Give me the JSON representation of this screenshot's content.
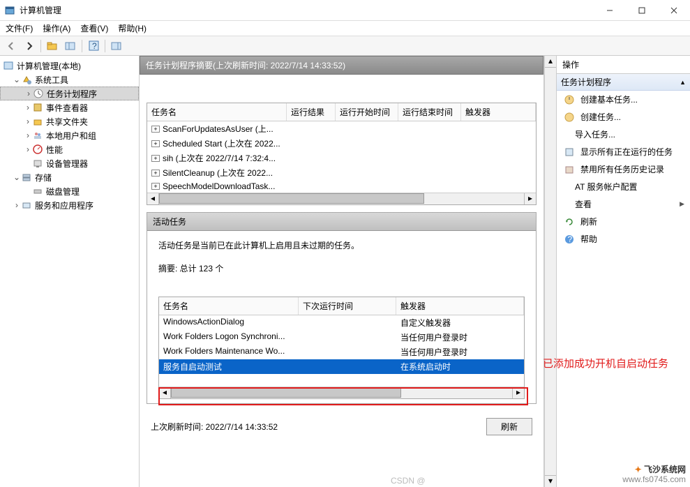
{
  "window": {
    "title": "计算机管理"
  },
  "window_controls": {
    "minimize": "minimize",
    "maximize": "maximize",
    "close": "close"
  },
  "menu": {
    "file": "文件(F)",
    "action": "操作(A)",
    "view": "查看(V)",
    "help": "帮助(H)"
  },
  "tree": {
    "root": "计算机管理(本地)",
    "system_tools": "系统工具",
    "task_scheduler": "任务计划程序",
    "event_viewer": "事件查看器",
    "shared_folders": "共享文件夹",
    "local_users": "本地用户和组",
    "performance": "性能",
    "device_manager": "设备管理器",
    "storage": "存储",
    "disk_mgmt": "磁盘管理",
    "services_apps": "服务和应用程序"
  },
  "mid": {
    "summary_header": "任务计划程序摘要(上次刷新时间: 2022/7/14 14:33:52)",
    "cols": {
      "name": "任务名",
      "result": "运行结果",
      "start": "运行开始时间",
      "end": "运行结束时间",
      "trigger": "触发器"
    },
    "tasks": [
      "ScanForUpdatesAsUser (上...",
      "Scheduled Start (上次在 2022...",
      "sih (上次在 2022/7/14 7:32:4...",
      "SilentCleanup (上次在 2022...",
      "SpeechModelDownloadTask..."
    ],
    "active_header": "活动任务",
    "active_desc": "活动任务是当前已在此计算机上启用且未过期的任务。",
    "active_summary": "摘要: 总计 123 个",
    "active_cols": {
      "name": "任务名",
      "next": "下次运行时间",
      "trigger": "触发器"
    },
    "active_rows": [
      {
        "name": "WindowsActionDialog",
        "next": "",
        "trigger": "自定义触发器"
      },
      {
        "name": "Work Folders Logon Synchroni...",
        "next": "",
        "trigger": "当任何用户登录时"
      },
      {
        "name": "Work Folders Maintenance Wo...",
        "next": "",
        "trigger": "当任何用户登录时"
      },
      {
        "name": "服务自启动测试",
        "next": "",
        "trigger": "在系统启动时"
      }
    ],
    "last_refresh": "上次刷新时间: 2022/7/14 14:33:52",
    "refresh_btn": "刷新"
  },
  "actions": {
    "header": "操作",
    "group": "任务计划程序",
    "create_basic": "创建基本任务...",
    "create_task": "创建任务...",
    "import": "导入任务...",
    "show_running": "显示所有正在运行的任务",
    "disable_history": "禁用所有任务历史记录",
    "at_service": "AT 服务帐户配置",
    "view": "查看",
    "refresh": "刷新",
    "help": "帮助"
  },
  "annotation": {
    "text": "已添加成功开机自启动任务"
  },
  "watermark": {
    "brand_prefix": "飞沙",
    "brand_suffix": "系统网",
    "url": "www.fs0745.com"
  },
  "csdn": "CSDN @"
}
